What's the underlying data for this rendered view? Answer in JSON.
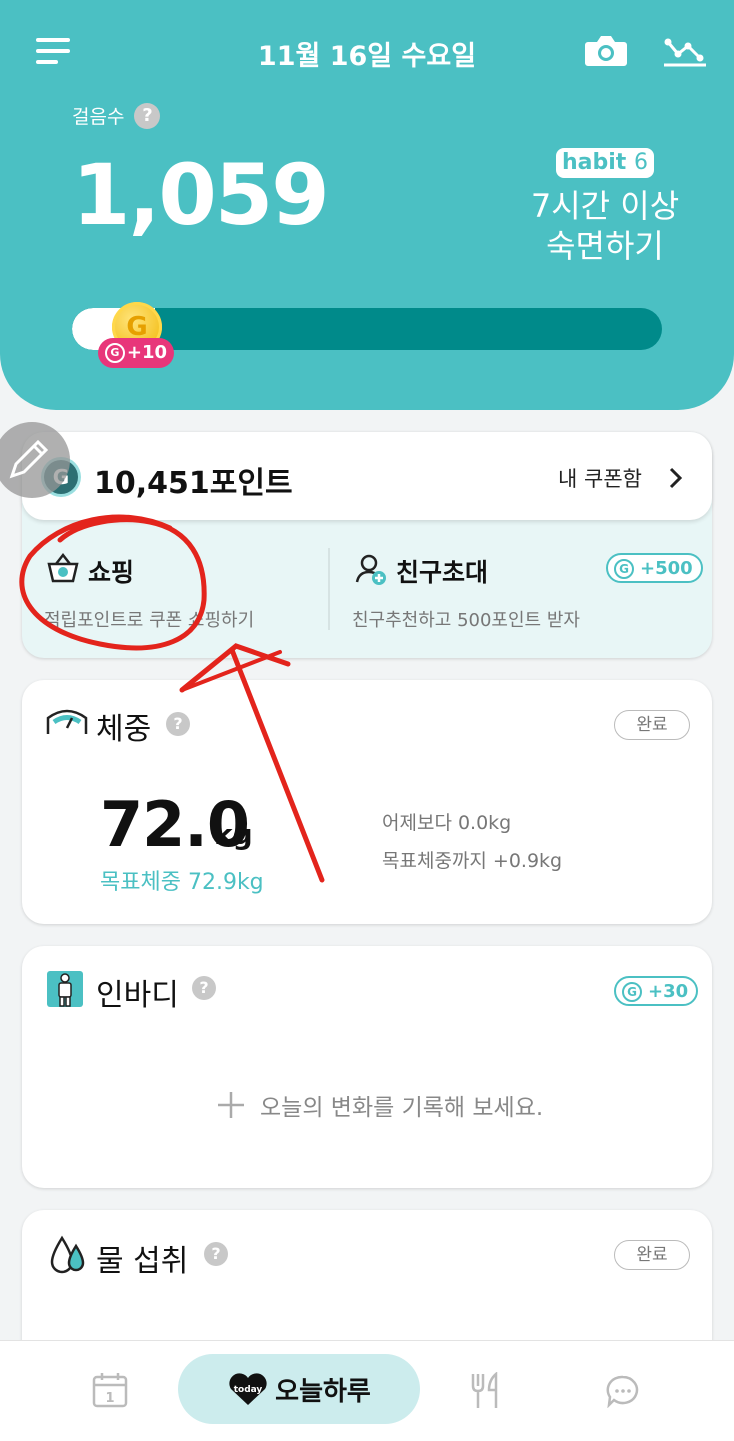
{
  "header": {
    "date": "11월 16일 수요일",
    "steps_label": "걸음수",
    "help_mark": "?",
    "steps_value": "1,059",
    "habit_badge_text": "habit",
    "habit_badge_number": "6",
    "habit_line1": "7시간 이상",
    "habit_line2": "숙면하기",
    "progress_fraction": 0.14,
    "coin_letter": "G",
    "reward_text": "+10"
  },
  "points": {
    "value": "10,451포인트",
    "coupon_link": "내 쿠폰함",
    "shopping_title": "쇼핑",
    "shopping_sub": "적립포인트로 쿠폰 쇼핑하기",
    "invite_title": "친구초대",
    "invite_sub": "친구추천하고 500포인트 받자",
    "invite_reward": "+500"
  },
  "weight": {
    "title": "체중",
    "done": "완료",
    "value": "72.0",
    "unit": "kg",
    "goal": "목표체중 72.9kg",
    "vs_yesterday": "어제보다 0.0kg",
    "to_goal": "목표체중까지 +0.9kg"
  },
  "inbody": {
    "title": "인바디",
    "reward": "+30",
    "empty_message": "오늘의 변화를 기록해 보세요."
  },
  "water": {
    "title": "물 섭취",
    "done": "완료"
  },
  "nav": {
    "today_badge": "today",
    "today_label": "오늘하루",
    "calendar_day": "1"
  },
  "colors": {
    "accent": "#4bc0c3",
    "progress_track": "#008a8a",
    "reward_pink": "#e8367a",
    "annotation_red": "#e3241c"
  },
  "icons": [
    "menu-icon",
    "camera-icon",
    "trend-icon",
    "help-icon",
    "g-coin-icon",
    "chevron-right-icon",
    "shopping-basket-icon",
    "invite-friend-icon",
    "scale-icon",
    "inbody-icon",
    "water-drop-icon",
    "plus-icon",
    "calendar-icon",
    "heart-icon",
    "utensils-icon",
    "chat-icon",
    "edit-pencil-icon"
  ]
}
